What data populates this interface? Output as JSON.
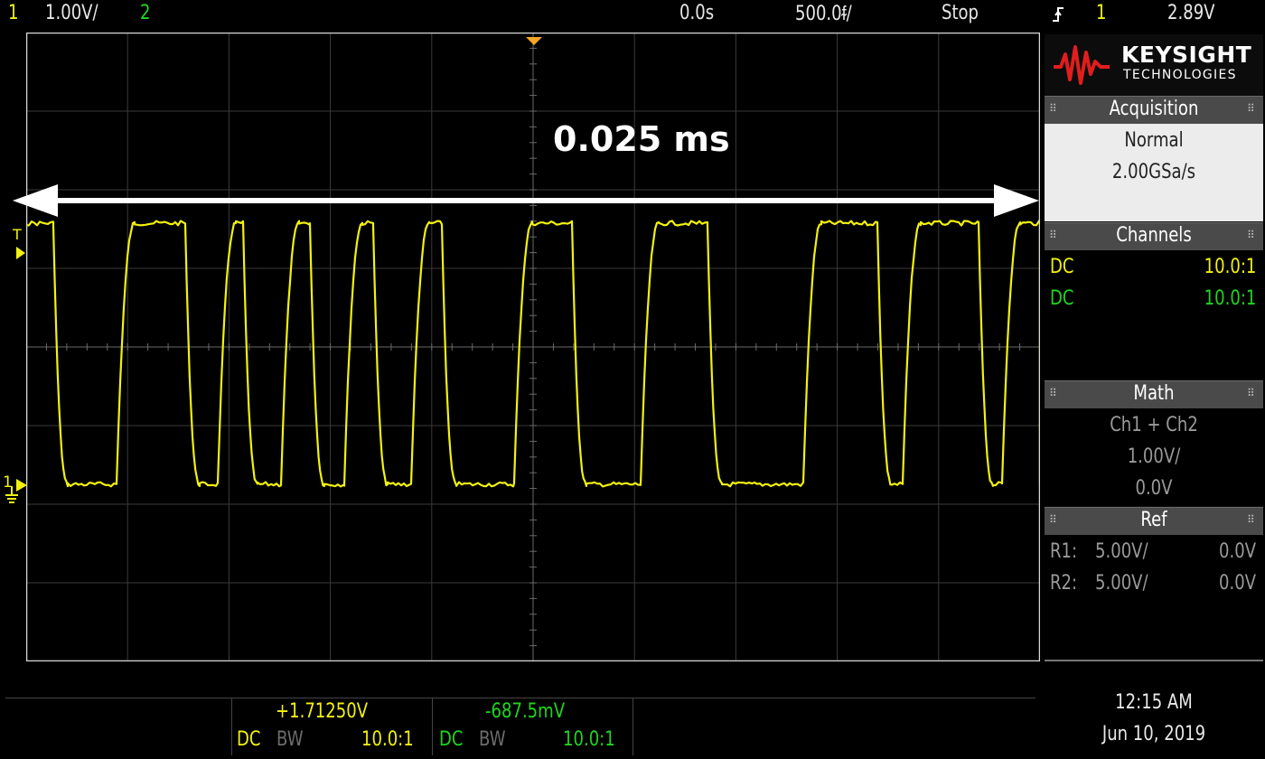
{
  "top_bar": {
    "ch1_num": "1",
    "ch1_scale": "1.00V/",
    "ch2_num": "2",
    "time_offset": "0.0s",
    "time_scale": "500.0ᵮ/",
    "run_state": "Stop",
    "trigger_icon": "rising-edge-trigger-icon",
    "trigger_ch": "1",
    "trigger_level": "2.89V"
  },
  "annotation": {
    "text": "0.025 ms"
  },
  "trigger_marker": "T",
  "ground_marker": "1",
  "brand": {
    "name": "KEYSIGHT",
    "sub": "TECHNOLOGIES"
  },
  "acquisition": {
    "title": "Acquisition",
    "mode": "Normal",
    "rate": "2.00GSa/s"
  },
  "channels": {
    "title": "Channels",
    "rows": [
      {
        "coupling": "DC",
        "probe": "10.0:1",
        "color": "#f2f20d"
      },
      {
        "coupling": "DC",
        "probe": "10.0:1",
        "color": "#1fd61f"
      }
    ]
  },
  "math": {
    "title": "Math",
    "func": "Ch1 + Ch2",
    "scale": "1.00V/",
    "offset": "0.0V"
  },
  "ref": {
    "title": "Ref",
    "rows": [
      {
        "name": "R1:",
        "scale": "5.00V/",
        "offset": "0.0V"
      },
      {
        "name": "R2:",
        "scale": "5.00V/",
        "offset": "0.0V"
      }
    ]
  },
  "bottom": {
    "ch1": {
      "value": "+1.71250V",
      "coupling": "DC",
      "bw": "BW",
      "probe": "10.0:1"
    },
    "ch2": {
      "value": "-687.5mV",
      "coupling": "DC",
      "bw": "BW",
      "probe": "10.0:1"
    },
    "time": "12:15 AM",
    "date": "Jun 10, 2019"
  },
  "colors": {
    "ch1": "#f2f20d",
    "ch2": "#1fd61f",
    "trigger": "#f5a623"
  }
}
